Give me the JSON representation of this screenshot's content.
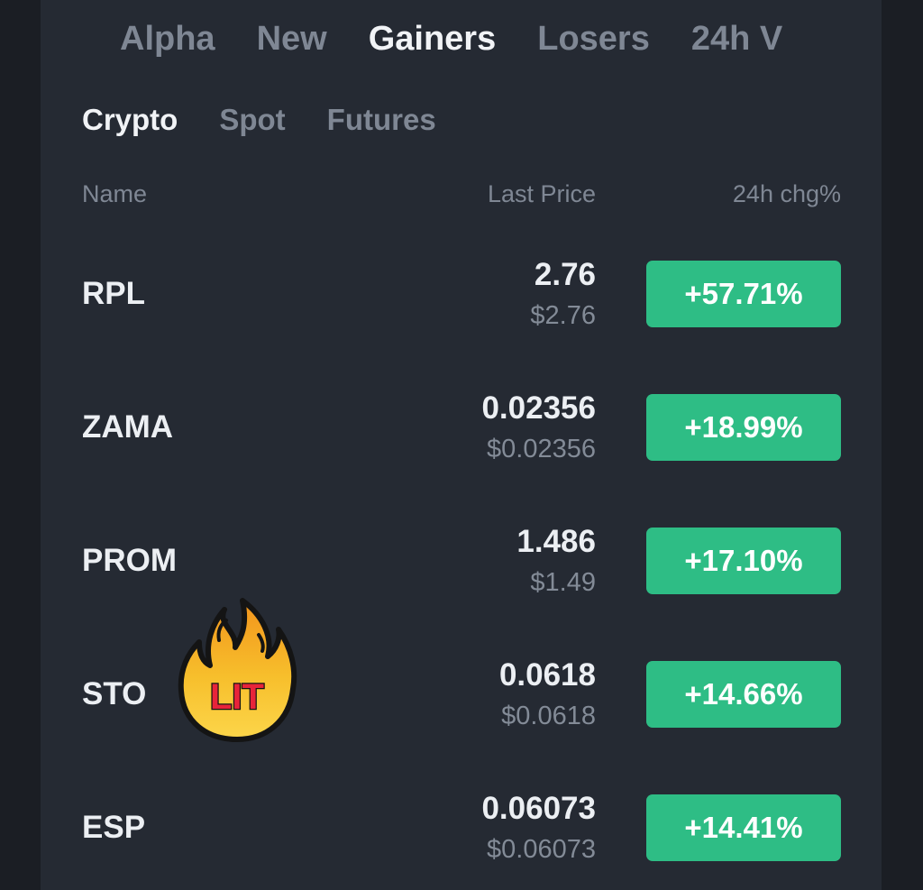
{
  "top_tabs": [
    "Alpha",
    "New",
    "Gainers",
    "Losers",
    "24h V"
  ],
  "active_top_tab": "Gainers",
  "sub_tabs": [
    "Crypto",
    "Spot",
    "Futures"
  ],
  "active_sub_tab": "Crypto",
  "columns": {
    "name": "Name",
    "last_price": "Last Price",
    "change": "24h chg%"
  },
  "rows": [
    {
      "symbol": "RPL",
      "last": "2.76",
      "usd": "$2.76",
      "change": "+57.71%"
    },
    {
      "symbol": "ZAMA",
      "last": "0.02356",
      "usd": "$0.02356",
      "change": "+18.99%"
    },
    {
      "symbol": "PROM",
      "last": "1.486",
      "usd": "$1.49",
      "change": "+17.10%"
    },
    {
      "symbol": "STO",
      "last": "0.0618",
      "usd": "$0.0618",
      "change": "+14.66%"
    },
    {
      "symbol": "ESP",
      "last": "0.06073",
      "usd": "$0.06073",
      "change": "+14.41%"
    }
  ],
  "sticker": {
    "text": "LIT",
    "icon": "fire-icon"
  },
  "colors": {
    "background": "#1b1e24",
    "panel": "#252a33",
    "gain": "#2ebd85",
    "text_primary": "#eceff3",
    "text_muted": "#7f8794"
  }
}
